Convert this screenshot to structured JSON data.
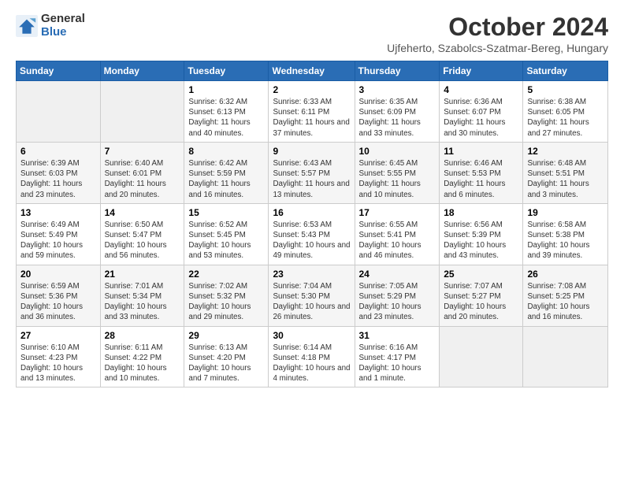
{
  "logo": {
    "general": "General",
    "blue": "Blue"
  },
  "title": {
    "month": "October 2024",
    "location": "Ujfeherto, Szabolcs-Szatmar-Bereg, Hungary"
  },
  "days_of_week": [
    "Sunday",
    "Monday",
    "Tuesday",
    "Wednesday",
    "Thursday",
    "Friday",
    "Saturday"
  ],
  "weeks": [
    [
      {
        "num": "",
        "info": ""
      },
      {
        "num": "",
        "info": ""
      },
      {
        "num": "1",
        "info": "Sunrise: 6:32 AM\nSunset: 6:13 PM\nDaylight: 11 hours and 40 minutes."
      },
      {
        "num": "2",
        "info": "Sunrise: 6:33 AM\nSunset: 6:11 PM\nDaylight: 11 hours and 37 minutes."
      },
      {
        "num": "3",
        "info": "Sunrise: 6:35 AM\nSunset: 6:09 PM\nDaylight: 11 hours and 33 minutes."
      },
      {
        "num": "4",
        "info": "Sunrise: 6:36 AM\nSunset: 6:07 PM\nDaylight: 11 hours and 30 minutes."
      },
      {
        "num": "5",
        "info": "Sunrise: 6:38 AM\nSunset: 6:05 PM\nDaylight: 11 hours and 27 minutes."
      }
    ],
    [
      {
        "num": "6",
        "info": "Sunrise: 6:39 AM\nSunset: 6:03 PM\nDaylight: 11 hours and 23 minutes."
      },
      {
        "num": "7",
        "info": "Sunrise: 6:40 AM\nSunset: 6:01 PM\nDaylight: 11 hours and 20 minutes."
      },
      {
        "num": "8",
        "info": "Sunrise: 6:42 AM\nSunset: 5:59 PM\nDaylight: 11 hours and 16 minutes."
      },
      {
        "num": "9",
        "info": "Sunrise: 6:43 AM\nSunset: 5:57 PM\nDaylight: 11 hours and 13 minutes."
      },
      {
        "num": "10",
        "info": "Sunrise: 6:45 AM\nSunset: 5:55 PM\nDaylight: 11 hours and 10 minutes."
      },
      {
        "num": "11",
        "info": "Sunrise: 6:46 AM\nSunset: 5:53 PM\nDaylight: 11 hours and 6 minutes."
      },
      {
        "num": "12",
        "info": "Sunrise: 6:48 AM\nSunset: 5:51 PM\nDaylight: 11 hours and 3 minutes."
      }
    ],
    [
      {
        "num": "13",
        "info": "Sunrise: 6:49 AM\nSunset: 5:49 PM\nDaylight: 10 hours and 59 minutes."
      },
      {
        "num": "14",
        "info": "Sunrise: 6:50 AM\nSunset: 5:47 PM\nDaylight: 10 hours and 56 minutes."
      },
      {
        "num": "15",
        "info": "Sunrise: 6:52 AM\nSunset: 5:45 PM\nDaylight: 10 hours and 53 minutes."
      },
      {
        "num": "16",
        "info": "Sunrise: 6:53 AM\nSunset: 5:43 PM\nDaylight: 10 hours and 49 minutes."
      },
      {
        "num": "17",
        "info": "Sunrise: 6:55 AM\nSunset: 5:41 PM\nDaylight: 10 hours and 46 minutes."
      },
      {
        "num": "18",
        "info": "Sunrise: 6:56 AM\nSunset: 5:39 PM\nDaylight: 10 hours and 43 minutes."
      },
      {
        "num": "19",
        "info": "Sunrise: 6:58 AM\nSunset: 5:38 PM\nDaylight: 10 hours and 39 minutes."
      }
    ],
    [
      {
        "num": "20",
        "info": "Sunrise: 6:59 AM\nSunset: 5:36 PM\nDaylight: 10 hours and 36 minutes."
      },
      {
        "num": "21",
        "info": "Sunrise: 7:01 AM\nSunset: 5:34 PM\nDaylight: 10 hours and 33 minutes."
      },
      {
        "num": "22",
        "info": "Sunrise: 7:02 AM\nSunset: 5:32 PM\nDaylight: 10 hours and 29 minutes."
      },
      {
        "num": "23",
        "info": "Sunrise: 7:04 AM\nSunset: 5:30 PM\nDaylight: 10 hours and 26 minutes."
      },
      {
        "num": "24",
        "info": "Sunrise: 7:05 AM\nSunset: 5:29 PM\nDaylight: 10 hours and 23 minutes."
      },
      {
        "num": "25",
        "info": "Sunrise: 7:07 AM\nSunset: 5:27 PM\nDaylight: 10 hours and 20 minutes."
      },
      {
        "num": "26",
        "info": "Sunrise: 7:08 AM\nSunset: 5:25 PM\nDaylight: 10 hours and 16 minutes."
      }
    ],
    [
      {
        "num": "27",
        "info": "Sunrise: 6:10 AM\nSunset: 4:23 PM\nDaylight: 10 hours and 13 minutes."
      },
      {
        "num": "28",
        "info": "Sunrise: 6:11 AM\nSunset: 4:22 PM\nDaylight: 10 hours and 10 minutes."
      },
      {
        "num": "29",
        "info": "Sunrise: 6:13 AM\nSunset: 4:20 PM\nDaylight: 10 hours and 7 minutes."
      },
      {
        "num": "30",
        "info": "Sunrise: 6:14 AM\nSunset: 4:18 PM\nDaylight: 10 hours and 4 minutes."
      },
      {
        "num": "31",
        "info": "Sunrise: 6:16 AM\nSunset: 4:17 PM\nDaylight: 10 hours and 1 minute."
      },
      {
        "num": "",
        "info": ""
      },
      {
        "num": "",
        "info": ""
      }
    ]
  ]
}
